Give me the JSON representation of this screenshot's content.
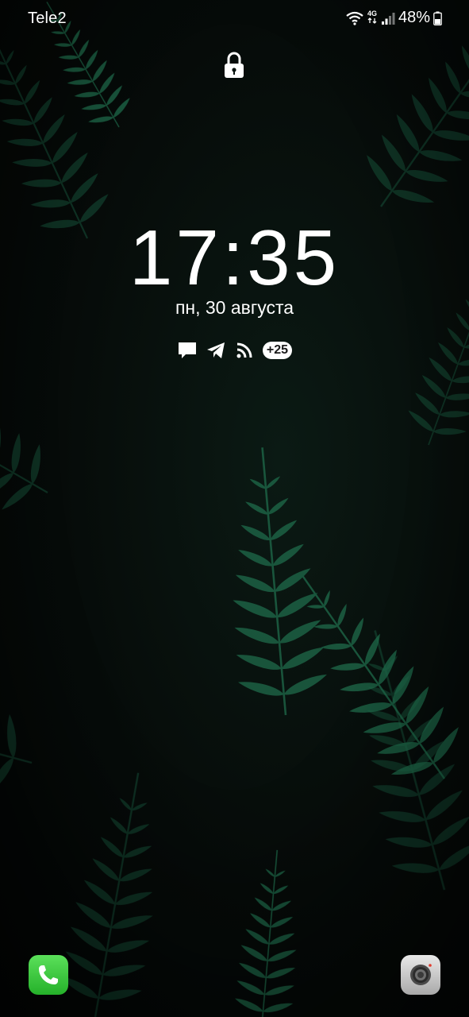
{
  "status_bar": {
    "carrier": "Tele2",
    "network_type": "4G",
    "battery_percent": "48%",
    "icons": [
      "wifi-icon",
      "4g-data-icon",
      "signal-icon",
      "battery-icon"
    ]
  },
  "lockscreen": {
    "lock_icon": "padlock-icon",
    "time": "17:35",
    "date": "пн, 30 августа",
    "notifications": {
      "icons": [
        "message-icon",
        "telegram-icon",
        "rss-feed-icon"
      ],
      "more_count": "+25"
    }
  },
  "shortcuts": {
    "left": "phone-icon",
    "right": "camera-icon"
  },
  "colors": {
    "wallpaper_dark": "#050807",
    "fern_green": "#1f6b4b",
    "phone_green": "#3cc93e",
    "camera_grey": "#c8c8c8"
  }
}
